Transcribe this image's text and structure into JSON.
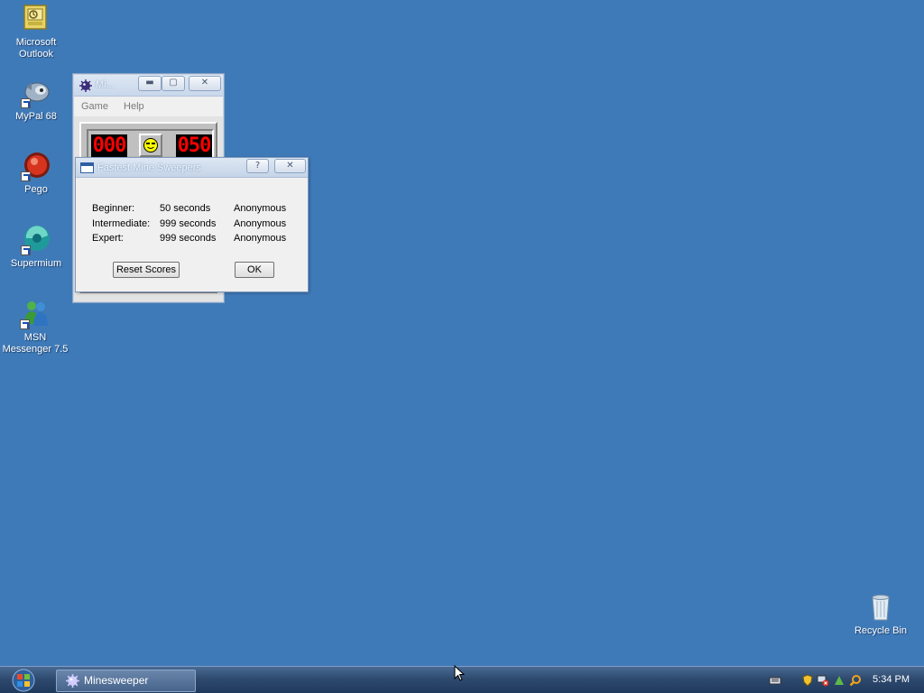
{
  "desktop": {
    "icons": [
      {
        "label_line1": "Microsoft",
        "label_line2": "Outlook",
        "icon": "outlook-icon"
      },
      {
        "label_line1": "MyPal 68",
        "label_line2": "",
        "icon": "mypal-icon"
      },
      {
        "label_line1": "Pego",
        "label_line2": "",
        "icon": "pego-icon"
      },
      {
        "label_line1": "Supermium",
        "label_line2": "",
        "icon": "supermium-icon"
      },
      {
        "label_line1": "MSN",
        "label_line2": "Messenger 7.5",
        "icon": "msn-messenger-icon"
      }
    ],
    "recycle_bin": {
      "label": "Recycle Bin",
      "icon": "recycle-bin-icon"
    }
  },
  "minesweeper": {
    "title": "Mi...",
    "menu": [
      "Game",
      "Help"
    ],
    "mines_counter": "000",
    "timer": "050",
    "face": "smiley-cool"
  },
  "dialog": {
    "title": "Fastest Mine Sweepers",
    "rows": [
      {
        "level": "Beginner:",
        "time": "50 seconds",
        "name": "Anonymous"
      },
      {
        "level": "Intermediate:",
        "time": "999 seconds",
        "name": "Anonymous"
      },
      {
        "level": "Expert:",
        "time": "999 seconds",
        "name": "Anonymous"
      }
    ],
    "reset_label": "Reset Scores",
    "ok_label": "OK",
    "help_glyph": "?",
    "close_glyph": "✕"
  },
  "taskbar": {
    "task_label": "Minesweeper",
    "clock": "5:34 PM"
  },
  "colors": {
    "desktop_bg": "#3f7ab8",
    "led_red": "#ff0000"
  }
}
